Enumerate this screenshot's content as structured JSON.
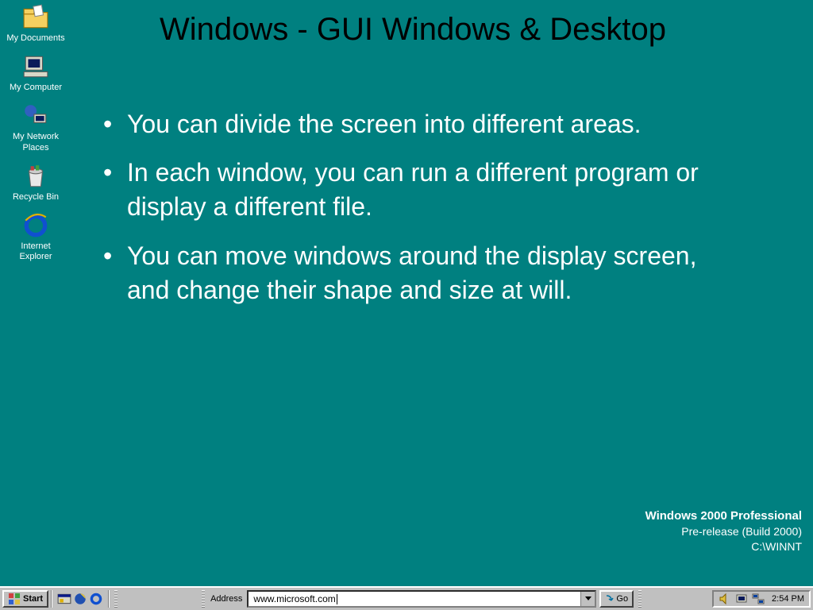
{
  "slide": {
    "title": "Windows - GUI Windows & Desktop",
    "bullets": [
      "You can divide the screen into different areas.",
      "In each window, you can run a different program or display a different file.",
      "You can move windows around the display screen, and change their shape and size at will."
    ]
  },
  "desktop_icons": [
    {
      "label": "My Documents",
      "name": "my-documents"
    },
    {
      "label": "My Computer",
      "name": "my-computer"
    },
    {
      "label": "My Network Places",
      "name": "my-network-places"
    },
    {
      "label": "Recycle Bin",
      "name": "recycle-bin"
    },
    {
      "label": "Internet Explorer",
      "name": "internet-explorer"
    }
  ],
  "stamp": {
    "line1": "Windows 2000 Professional",
    "line2": "Pre-release (Build 2000)",
    "line3": "C:\\WINNT"
  },
  "taskbar": {
    "start": "Start",
    "address_label": "Address",
    "address_value": "www.microsoft.com",
    "go": "Go",
    "clock": "2:54 PM"
  }
}
